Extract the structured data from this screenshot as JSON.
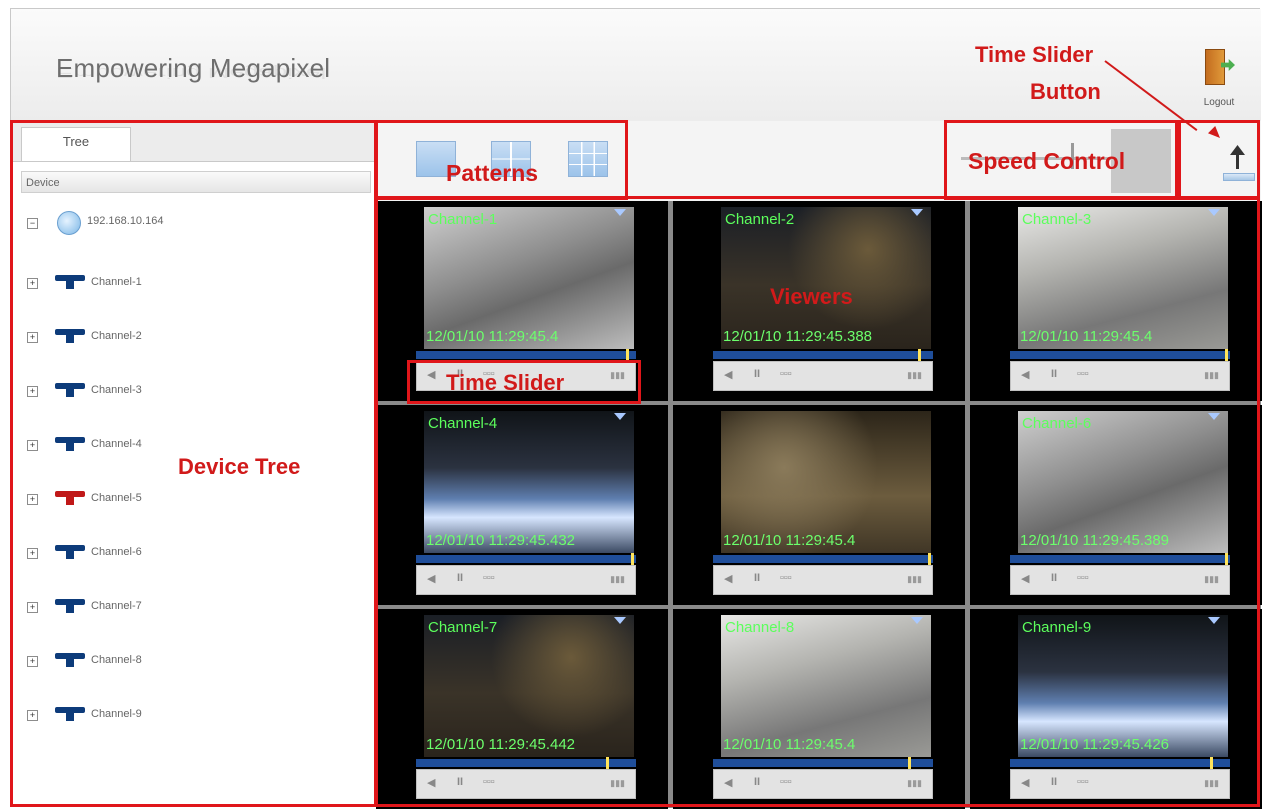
{
  "header": {
    "brand": "Empowering Megapixel",
    "logout_label": "Logout"
  },
  "left_panel": {
    "tab": "Tree",
    "column_header": "Device",
    "root": "192.168.10.164",
    "channels": [
      {
        "label": "Channel-1",
        "status": "blue"
      },
      {
        "label": "Channel-2",
        "status": "blue"
      },
      {
        "label": "Channel-3",
        "status": "blue"
      },
      {
        "label": "Channel-4",
        "status": "blue"
      },
      {
        "label": "Channel-5",
        "status": "red"
      },
      {
        "label": "Channel-6",
        "status": "blue"
      },
      {
        "label": "Channel-7",
        "status": "blue"
      },
      {
        "label": "Channel-8",
        "status": "blue"
      },
      {
        "label": "Channel-9",
        "status": "blue"
      }
    ]
  },
  "viewers": [
    {
      "channel": "Channel-1",
      "timestamp": "12/01/10 11:29:45.4"
    },
    {
      "channel": "Channel-2",
      "timestamp": "12/01/10 11:29:45.388"
    },
    {
      "channel": "Channel-3",
      "timestamp": "12/01/10 11:29:45.4"
    },
    {
      "channel": "Channel-4",
      "timestamp": "12/01/10 11:29:45.432"
    },
    {
      "channel": "",
      "timestamp": "12/01/10 11:29:45.4"
    },
    {
      "channel": "Channel-6",
      "timestamp": "12/01/10 11:29:45.389"
    },
    {
      "channel": "Channel-7",
      "timestamp": "12/01/10 11:29:45.442"
    },
    {
      "channel": "Channel-8",
      "timestamp": "12/01/10 11:29:45.4"
    },
    {
      "channel": "Channel-9",
      "timestamp": "12/01/10 11:29:45.426"
    }
  ],
  "annotations": {
    "patterns": "Patterns",
    "speed_control": "Speed Control",
    "time_slider_button_line1": "Time Slider",
    "time_slider_button_line2": "Button",
    "device_tree": "Device Tree",
    "viewers": "Viewers",
    "time_slider": "Time Slider"
  },
  "colors": {
    "annotation_red": "#e0161a",
    "osd_green": "#5cff5c",
    "timeline_blue": "#1f4e9a",
    "camera_online": "#0d3b7a",
    "camera_alarm": "#c01818"
  },
  "icons": {
    "logout": "door-exit-icon",
    "root_device": "globe-icon",
    "channel": "camera-icon",
    "time_slider_button": "arrow-up-icon",
    "patterns": [
      "layout-1x1-icon",
      "layout-2x2-icon",
      "layout-3x3-icon"
    ]
  }
}
